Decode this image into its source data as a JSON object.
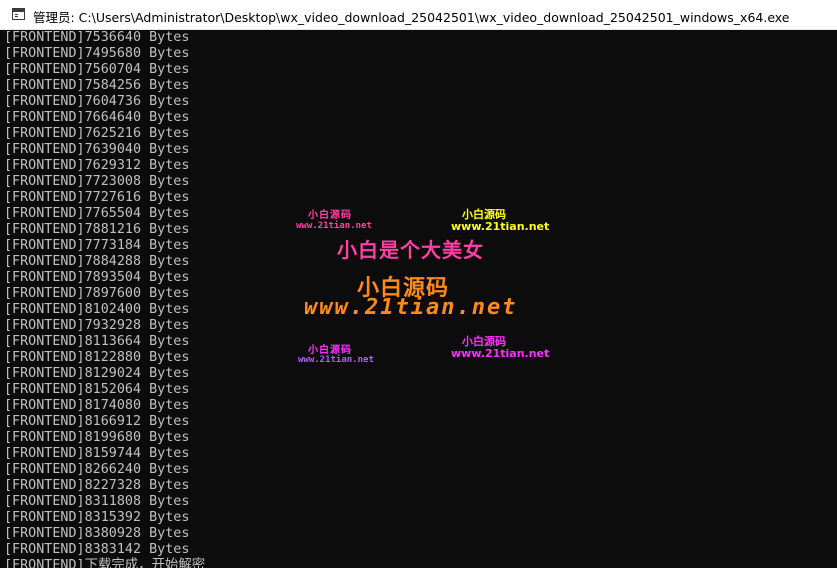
{
  "window": {
    "title": "管理员: C:\\Users\\Administrator\\Desktop\\wx_video_download_25042501\\wx_video_download_25042501_windows_x64.exe",
    "icon": "console-window-icon"
  },
  "console": {
    "lines": [
      "[FRONTEND]7536640 Bytes",
      "[FRONTEND]7495680 Bytes",
      "[FRONTEND]7560704 Bytes",
      "[FRONTEND]7584256 Bytes",
      "[FRONTEND]7604736 Bytes",
      "[FRONTEND]7664640 Bytes",
      "[FRONTEND]7625216 Bytes",
      "[FRONTEND]7639040 Bytes",
      "[FRONTEND]7629312 Bytes",
      "[FRONTEND]7723008 Bytes",
      "[FRONTEND]7727616 Bytes",
      "[FRONTEND]7765504 Bytes",
      "[FRONTEND]7881216 Bytes",
      "[FRONTEND]7773184 Bytes",
      "[FRONTEND]7884288 Bytes",
      "[FRONTEND]7893504 Bytes",
      "[FRONTEND]7897600 Bytes",
      "[FRONTEND]8102400 Bytes",
      "[FRONTEND]7932928 Bytes",
      "[FRONTEND]8113664 Bytes",
      "[FRONTEND]8122880 Bytes",
      "[FRONTEND]8129024 Bytes",
      "[FRONTEND]8152064 Bytes",
      "[FRONTEND]8174080 Bytes",
      "[FRONTEND]8166912 Bytes",
      "[FRONTEND]8199680 Bytes",
      "[FRONTEND]8159744 Bytes",
      "[FRONTEND]8266240 Bytes",
      "[FRONTEND]8227328 Bytes",
      "[FRONTEND]8311808 Bytes",
      "[FRONTEND]8315392 Bytes",
      "[FRONTEND]8380928 Bytes",
      "[FRONTEND]8383142 Bytes",
      "[FRONTEND]下载完成，开始解密"
    ]
  },
  "watermark": {
    "brand_small_1": "小白源码",
    "site_small_1": "www.21tian.net",
    "brand_small_2": "小白源码",
    "site_small_2": "www.21tian.net",
    "slogan": "小白是个大美女",
    "brand_large": "小白源码",
    "site_large": "www.21tian.net",
    "brand_small_3": "小白源码",
    "site_small_3": "www.21tian.net",
    "brand_small_4": "小白源码",
    "site_small_4": "www.21tian.net",
    "colors": {
      "pink": "#ff3fa4",
      "yellow": "#ffff1a",
      "orange": "#ff8a1a",
      "magenta": "#ff30ff",
      "purple": "#b05cff"
    }
  }
}
